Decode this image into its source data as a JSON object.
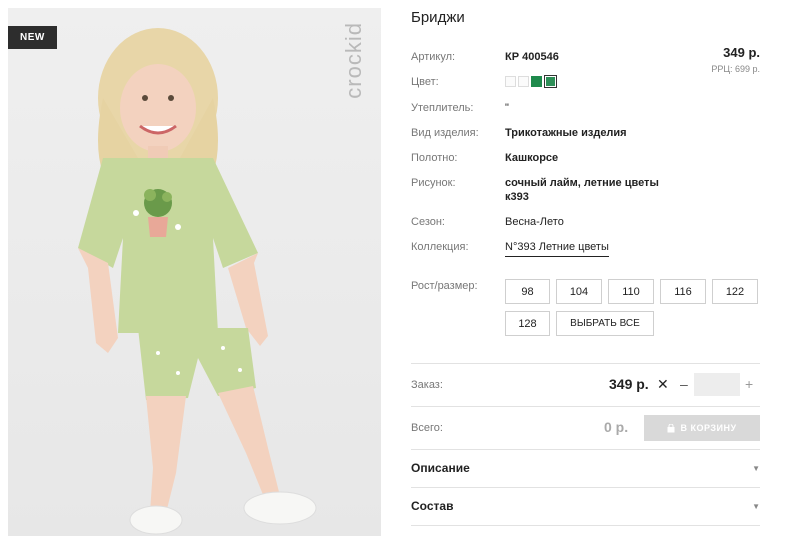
{
  "product": {
    "badge": "NEW",
    "brand": "crockid",
    "title": "Бриджи",
    "price": "349 р.",
    "rrp": "РРЦ: 699 р."
  },
  "details": [
    {
      "label": "Артикул:",
      "value": "КР 400546"
    },
    {
      "label": "Цвет:",
      "value": ""
    },
    {
      "label": "Утеплитель:",
      "value": "\""
    },
    {
      "label": "Вид изделия:",
      "value": "Трикотажные изделия"
    },
    {
      "label": "Полотно:",
      "value": "Кашкорсе"
    },
    {
      "label": "Рисунок:",
      "value": "сочный лайм, летние цветы",
      "value2": "к393"
    },
    {
      "label": "Сезон:",
      "value": "Весна-Лето"
    },
    {
      "label": "Коллекция:",
      "value": "N°393 Летние цветы"
    }
  ],
  "colors": [
    "#fbfbfb",
    "#fbfbfb",
    "#1f8a4c",
    "#2e8f58"
  ],
  "sizes": {
    "label": "Рост/размер:",
    "items": [
      "98",
      "104",
      "110",
      "116",
      "122",
      "128"
    ],
    "select_all": "ВЫБРАТЬ ВСЕ"
  },
  "order": {
    "label": "Заказ:",
    "price": "349 р.",
    "times": "✕",
    "minus": "–",
    "plus": "+",
    "qty": ""
  },
  "total": {
    "label": "Всего:",
    "value": "0 р.",
    "cart_label": "В КОРЗИНУ"
  },
  "accordions": [
    {
      "title": "Описание"
    },
    {
      "title": "Состав"
    }
  ]
}
